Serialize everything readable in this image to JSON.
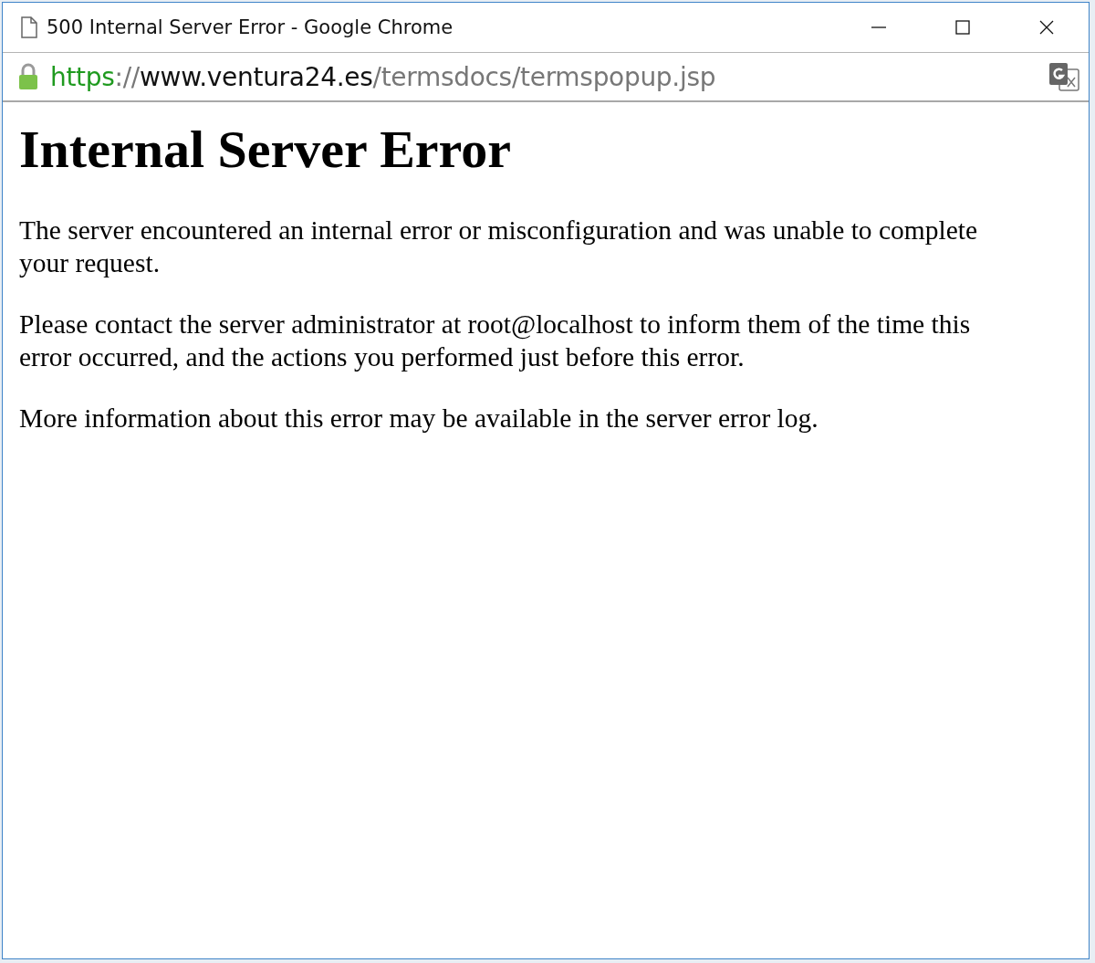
{
  "window": {
    "title": "500 Internal Server Error - Google Chrome"
  },
  "address_bar": {
    "secure": true,
    "scheme": "https",
    "separator": "://",
    "host": "www.ventura24.es",
    "path": "/termsdocs/termspopup.jsp"
  },
  "page": {
    "heading": "Internal Server Error",
    "paragraphs": [
      "The server encountered an internal error or misconfiguration and was unable to complete your request.",
      "Please contact the server administrator at root@localhost to inform them of the time this error occurred, and the actions you performed just before this error.",
      "More information about this error may be available in the server error log."
    ]
  }
}
